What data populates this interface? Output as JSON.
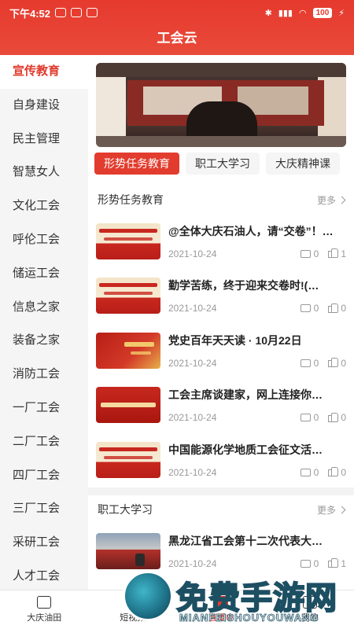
{
  "status_bar": {
    "time": "下午4:52",
    "battery": "100"
  },
  "header": {
    "title": "工会云"
  },
  "left_nav": [
    {
      "label": "宣传教育",
      "active": true
    },
    {
      "label": "自身建设"
    },
    {
      "label": "民主管理"
    },
    {
      "label": "智慧女人"
    },
    {
      "label": "文化工会"
    },
    {
      "label": "呼伦工会"
    },
    {
      "label": "储运工会"
    },
    {
      "label": "信息之家"
    },
    {
      "label": "装备之家"
    },
    {
      "label": "消防工会"
    },
    {
      "label": "一厂工会"
    },
    {
      "label": "二厂工会"
    },
    {
      "label": "四厂工会"
    },
    {
      "label": "三厂工会"
    },
    {
      "label": "采研工会"
    },
    {
      "label": "人才工会"
    }
  ],
  "tabs": [
    {
      "label": "形势任务教育",
      "active": true
    },
    {
      "label": "职工大学习"
    },
    {
      "label": "大庆精神课"
    }
  ],
  "sections": [
    {
      "title": "形势任务教育",
      "more": "更多",
      "articles": [
        {
          "title": "@全体大庆石油人，请“交卷”！…",
          "date": "2021-10-24",
          "comments": "0",
          "likes": "1"
        },
        {
          "title": "勤学苦练，终于迎来交卷时!(…",
          "date": "2021-10-24",
          "comments": "0",
          "likes": "0"
        },
        {
          "title": "党史百年天天读 · 10月22日",
          "date": "2021-10-24",
          "comments": "0",
          "likes": "0"
        },
        {
          "title": "工会主席谈建家，网上连接你…",
          "date": "2021-10-24",
          "comments": "0",
          "likes": "0"
        },
        {
          "title": "中国能源化学地质工会征文活…",
          "date": "2021-10-24",
          "comments": "0",
          "likes": "0"
        }
      ]
    },
    {
      "title": "职工大学习",
      "more": "更多",
      "articles": [
        {
          "title": "黑龙江省工会第十二次代表大…",
          "date": "2021-10-24",
          "comments": "0",
          "likes": "1"
        }
      ]
    }
  ],
  "bottom_nav": [
    {
      "label": "大庆油田",
      "icon": "home-icon"
    },
    {
      "label": "短视频",
      "icon": "video-icon"
    },
    {
      "label": "直播中",
      "icon": "live-icon",
      "active": true
    },
    {
      "label": "我的",
      "icon": "user-icon"
    }
  ],
  "watermark": {
    "text": "免费手游网",
    "sub": "MIANFEISHOUYOUWANG"
  },
  "colors": {
    "accent": "#e23c2e",
    "header": "#e63a2e"
  }
}
